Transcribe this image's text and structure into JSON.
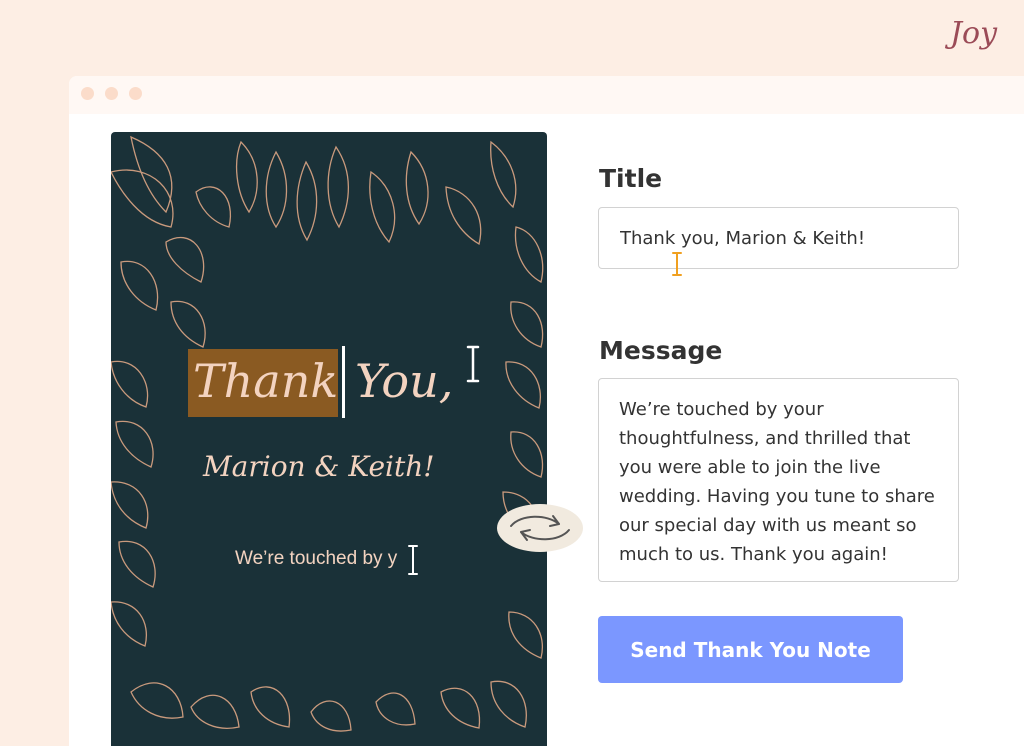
{
  "brand": {
    "logo_text": "Joy",
    "color": "#9b4b57"
  },
  "window": {
    "controls": [
      "dot",
      "dot",
      "dot"
    ],
    "dot_color": "#fbdcca"
  },
  "card": {
    "background": "#1a3138",
    "accent": "#c99a7d",
    "headline_selected": "Thank",
    "headline_rest": "You,",
    "names": "Marion & Keith!",
    "message_preview": "We’re touched by y"
  },
  "form": {
    "title_label": "Title",
    "title_value": "Thank you, Marion & Keith!",
    "message_label": "Message",
    "message_value": "We’re touched by your thoughtfulness, and thrilled that you were able to join the live wedding. Having you tune to share our special day with us meant so much to us. Thank you again!",
    "send_button": "Send Thank You Note",
    "button_color": "#7b97ff"
  },
  "icons": {
    "text_cursor": "i-beam-icon",
    "swap": "swap-arrows-icon"
  }
}
